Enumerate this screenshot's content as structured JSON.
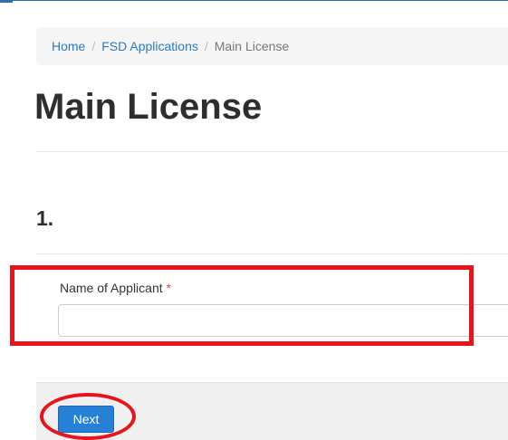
{
  "breadcrumb": {
    "items": [
      {
        "label": "Home",
        "link": true
      },
      {
        "label": "FSD Applications",
        "link": true
      },
      {
        "label": "Main License",
        "link": false
      }
    ],
    "separator": "/"
  },
  "page": {
    "title": "Main License",
    "section_number": "1."
  },
  "form": {
    "applicant_name": {
      "label": "Name of Applicant",
      "required_marker": "*",
      "value": "",
      "placeholder": ""
    }
  },
  "footer": {
    "next_label": "Next"
  },
  "annotations": {
    "highlight_color": "#e8141c",
    "shapes": [
      "rectangle around Name of Applicant field",
      "ellipse around Next button"
    ]
  },
  "colors": {
    "link": "#2a7bbf",
    "button_primary": "#2580d6",
    "required": "#d9534f",
    "top_rule": "#2f6fb0"
  }
}
